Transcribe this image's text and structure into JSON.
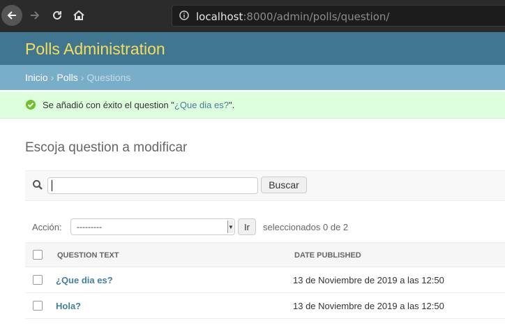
{
  "browser": {
    "url_host": "localhost",
    "url_rest": ":8000/admin/polls/question/"
  },
  "header": {
    "brand": "Polls Administration"
  },
  "breadcrumbs": {
    "home": "Inicio",
    "app": "Polls",
    "current": "Questions",
    "separator": "›"
  },
  "message": {
    "prefix": "Se añadió con éxito el question \"",
    "link": "¿Que dia es?",
    "suffix": "\"."
  },
  "page": {
    "title": "Escoja question a modificar"
  },
  "search": {
    "value": "",
    "button_label": "Buscar"
  },
  "actions": {
    "label": "Acción:",
    "selected_option": "---------",
    "go_label": "Ir",
    "selection_count": "seleccionados 0 de 2"
  },
  "table": {
    "columns": [
      "QUESTION TEXT",
      "DATE PUBLISHED"
    ],
    "rows": [
      {
        "question_text": "¿Que dia es?",
        "date_published": "13 de Noviembre de 2019 a las 12:50"
      },
      {
        "question_text": "Hola?",
        "date_published": "13 de Noviembre de 2019 a las 12:50"
      }
    ]
  },
  "colors": {
    "header_bg": "#417690",
    "brand": "#f5dd5d",
    "breadcrumbs_bg": "#79aec8",
    "success_bg": "#ddffdd",
    "link": "#447e9b"
  }
}
